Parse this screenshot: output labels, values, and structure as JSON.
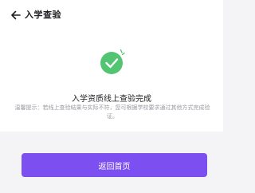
{
  "header": {
    "title": "入学查验",
    "back_icon": "arrow-left-icon"
  },
  "result": {
    "icon": "check-circle-icon",
    "title": "入学资质线上查验完成",
    "note": "温馨提示：若线上查验结果与实际不符，您可根据学校要求通过其他方式完成验证。"
  },
  "actions": {
    "home_button_label": "返回首页"
  },
  "colors": {
    "accent": "#7b4ff0",
    "success": "#52c472",
    "background": "#f4f4f6"
  }
}
